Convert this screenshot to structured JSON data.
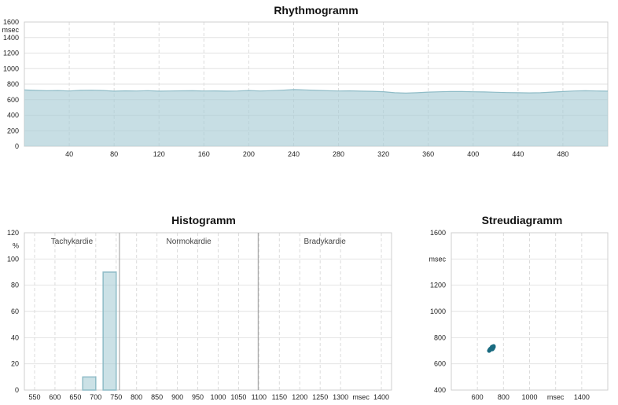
{
  "chart_data": [
    {
      "type": "area",
      "title": "Rhythmogramm",
      "ylabel": "msec",
      "ylim": [
        0,
        1600
      ],
      "yticks": [
        0,
        200,
        400,
        600,
        800,
        1000,
        1200,
        1400,
        1600
      ],
      "xlim": [
        0,
        520
      ],
      "xticks": [
        40,
        80,
        120,
        160,
        200,
        240,
        280,
        320,
        360,
        400,
        440,
        480
      ],
      "grid": true,
      "color": "#a9cdd6",
      "series": [
        {
          "x": [
            0,
            10,
            20,
            30,
            40,
            50,
            60,
            70,
            80,
            90,
            100,
            110,
            120,
            130,
            140,
            150,
            160,
            170,
            180,
            190,
            200,
            210,
            220,
            230,
            240,
            250,
            260,
            270,
            280,
            290,
            300,
            310,
            320,
            330,
            340,
            350,
            360,
            370,
            380,
            390,
            400,
            410,
            420,
            430,
            440,
            450,
            460,
            470,
            480,
            490,
            500,
            510,
            520
          ],
          "values": [
            725,
            720,
            715,
            718,
            712,
            720,
            722,
            718,
            710,
            714,
            712,
            716,
            710,
            712,
            714,
            715,
            712,
            713,
            710,
            712,
            718,
            712,
            716,
            722,
            730,
            726,
            720,
            715,
            712,
            714,
            710,
            708,
            703,
            690,
            685,
            690,
            698,
            702,
            706,
            705,
            702,
            700,
            696,
            692,
            690,
            688,
            690,
            698,
            705,
            712,
            715,
            712,
            710
          ]
        }
      ]
    },
    {
      "type": "bar",
      "title": "Histogramm",
      "ylabel": "%",
      "ylim": [
        0,
        120
      ],
      "yticks": [
        0,
        20,
        40,
        60,
        80,
        100,
        120
      ],
      "xunit": "msec",
      "xlim": [
        525,
        1425
      ],
      "xticks": [
        550,
        600,
        650,
        700,
        750,
        800,
        850,
        900,
        950,
        1000,
        1050,
        1100,
        1150,
        1200,
        1250,
        1300,
        1400
      ],
      "grid": true,
      "color": "#a9cdd6",
      "bars": [
        {
          "x": 684,
          "width": 32,
          "value": 10
        },
        {
          "x": 734,
          "width": 32,
          "value": 90
        }
      ],
      "regions": [
        {
          "label": "Tachykardie",
          "from": 525,
          "to": 758
        },
        {
          "label": "Normokardie",
          "from": 758,
          "to": 1098
        },
        {
          "label": "Bradykardie",
          "from": 1098,
          "to": 1425
        }
      ],
      "separators": [
        758,
        1098
      ]
    },
    {
      "type": "scatter",
      "title": "Streudiagramm",
      "ylabel": "msec",
      "xunit": "msec",
      "xlim": [
        400,
        1600
      ],
      "ylim": [
        400,
        1600
      ],
      "xticks": [
        600,
        800,
        1000,
        1400
      ],
      "yticks": [
        400,
        600,
        800,
        1000,
        1200,
        1600
      ],
      "grid": true,
      "color": "#1a6b80",
      "points": [
        [
          690,
          700
        ],
        [
          695,
          705
        ],
        [
          700,
          708
        ],
        [
          702,
          712
        ],
        [
          705,
          715
        ],
        [
          708,
          718
        ],
        [
          710,
          720
        ],
        [
          712,
          722
        ],
        [
          715,
          725
        ],
        [
          718,
          728
        ],
        [
          720,
          730
        ],
        [
          722,
          733
        ],
        [
          725,
          735
        ],
        [
          715,
          712
        ],
        [
          705,
          720
        ],
        [
          712,
          730
        ],
        [
          720,
          718
        ],
        [
          700,
          715
        ],
        [
          725,
          728
        ],
        [
          695,
          710
        ]
      ]
    }
  ]
}
